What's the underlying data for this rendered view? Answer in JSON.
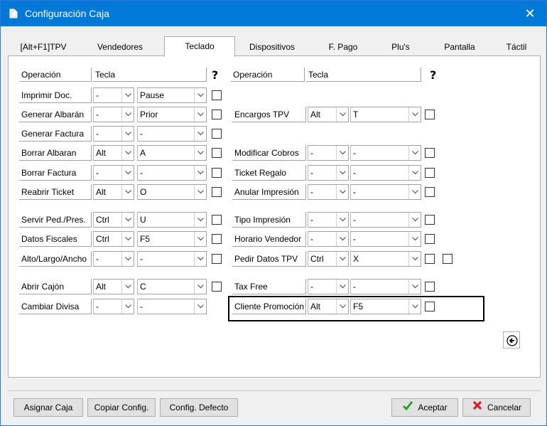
{
  "window": {
    "title": "Configuración Caja",
    "close_glyph": "✕"
  },
  "tabs": [
    "[Alt+F1]TPV",
    "Vendedores",
    "Teclado",
    "Dispositivos",
    "F. Pago",
    "Plu's",
    "Pantalla",
    "Táctil"
  ],
  "active_tab": "Teclado",
  "headers": {
    "operation": "Operación",
    "key": "Tecla",
    "help_glyph": "?"
  },
  "left_rows": [
    {
      "label": "Imprimir Doc.",
      "mod": "-",
      "key": "Pause",
      "checked": false
    },
    {
      "label": "Generar Albarán",
      "mod": "-",
      "key": "Prior",
      "checked": false
    },
    {
      "label": "Generar Factura",
      "mod": "-",
      "key": "-",
      "checked": false
    },
    {
      "label": "Borrar Albaran",
      "mod": "Alt",
      "key": "A",
      "checked": false
    },
    {
      "label": "Borrar Factura",
      "mod": "-",
      "key": "-",
      "checked": false
    },
    {
      "label": "Reabrir Ticket",
      "mod": "Alt",
      "key": "O",
      "checked": false
    },
    {
      "label": "Servir Ped./Pres.",
      "mod": "Ctrl",
      "key": "U",
      "checked": false
    },
    {
      "label": "Datos Fiscales",
      "mod": "Ctrl",
      "key": "F5",
      "checked": false
    },
    {
      "label": "Alto/Largo/Ancho",
      "mod": "-",
      "key": "-",
      "checked": false
    },
    {
      "label": "Abrir Cajón",
      "mod": "Alt",
      "key": "C",
      "checked": false
    },
    {
      "label": "Cambiar Divisa",
      "mod": "-",
      "key": "-"
    }
  ],
  "right_rows": [
    {
      "label": "Encargos TPV",
      "mod": "Alt",
      "key": "T",
      "checked": false
    },
    {
      "label": "Modificar Cobros",
      "mod": "-",
      "key": "-",
      "checked": false
    },
    {
      "label": "Ticket Regalo",
      "mod": "-",
      "key": "-",
      "checked": false
    },
    {
      "label": "Anular Impresión",
      "mod": "-",
      "key": "-",
      "checked": false
    },
    {
      "label": "Tipo Impresión",
      "mod": "-",
      "key": "-",
      "checked": false
    },
    {
      "label": "Horario Vendedor",
      "mod": "-",
      "key": "-",
      "checked": false
    },
    {
      "label": "Pedir Datos TPV",
      "mod": "Ctrl",
      "key": "X",
      "checked": false
    },
    {
      "label": "Tax Free",
      "mod": "-",
      "key": "-",
      "checked": false
    },
    {
      "label": "Cliente Promoción",
      "mod": "Alt",
      "key": "F5",
      "checked": false
    }
  ],
  "footer": {
    "assign": "Asignar Caja",
    "copy": "Copiar Config.",
    "default": "Config. Defecto",
    "accept": "Aceptar",
    "cancel": "Cancelar"
  },
  "colors": {
    "titlebar": "#0078d7",
    "accept_check": "#2e9a2e",
    "cancel_x": "#d9202a"
  }
}
